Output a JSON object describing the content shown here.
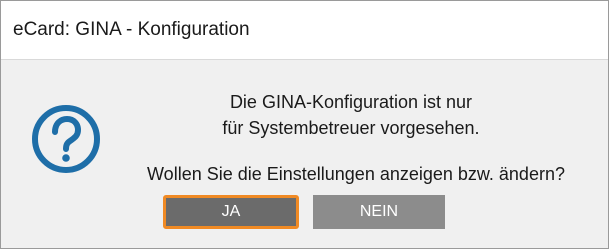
{
  "window": {
    "title": "eCard: GINA - Konfiguration"
  },
  "dialog": {
    "icon": "question-mark-circle-icon",
    "message_line1": "Die GINA-Konfiguration ist nur",
    "message_line2": "für Systembetreuer vorgesehen.",
    "question": "Wollen Sie die Einstellungen anzeigen bzw. ändern?"
  },
  "buttons": {
    "yes_label": "JA",
    "no_label": "NEIN"
  },
  "colors": {
    "accent_focus": "#f08a24",
    "icon_blue": "#1e6ea8",
    "button_primary": "#6b6b6b",
    "button_secondary": "#8c8c8c"
  }
}
